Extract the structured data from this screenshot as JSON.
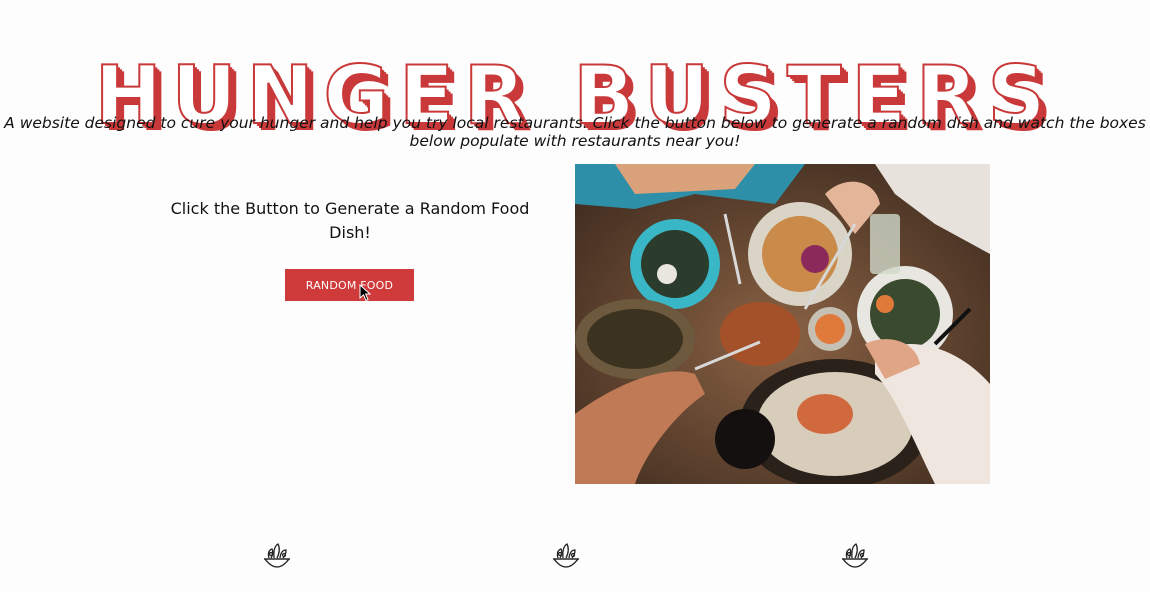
{
  "header": {
    "title": "HUNGER BUSTERS",
    "tagline": "A website designed to cure your hunger and help you try local restaurants. Click the button below to generate a random dish and watch the boxes below populate with restaurants near you!"
  },
  "main": {
    "cta_text": "Click the Button to Generate a Random Food Dish!",
    "button_label": "RANDOM FOOD"
  },
  "icons": [
    "salad-bowl-icon",
    "salad-bowl-icon",
    "salad-bowl-icon"
  ],
  "colors": {
    "brand_red": "#c9393a",
    "button_red": "#cf3b3b",
    "background": "#fdfdfd"
  }
}
